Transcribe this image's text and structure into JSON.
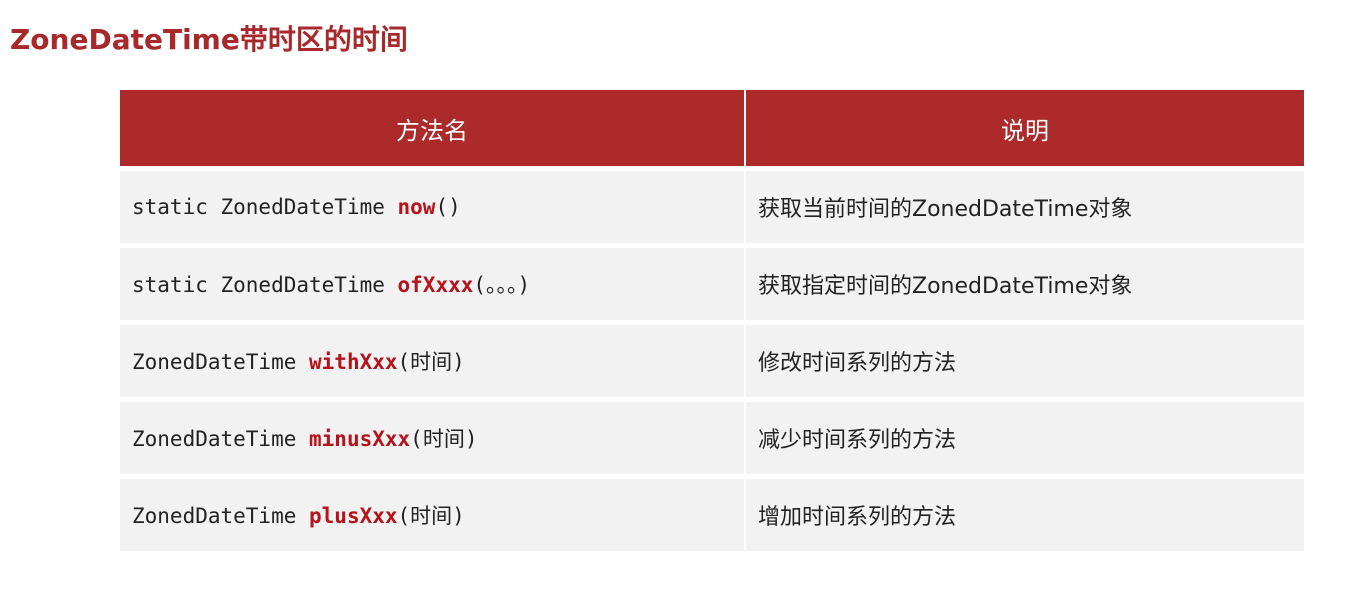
{
  "title": "ZoneDateTime带时区的时间",
  "colors": {
    "title": "#a8292b",
    "header_bg": "#ac2a29",
    "row_bg": "#f2f2f2",
    "method_highlight": "#b5121b"
  },
  "table": {
    "headers": [
      "方法名",
      "说明"
    ],
    "rows": [
      {
        "prefix": "static ZonedDateTime ",
        "method": "now",
        "suffix": "()",
        "description": "获取当前时间的ZonedDateTime对象"
      },
      {
        "prefix": "static ZonedDateTime ",
        "method": "ofXxxx",
        "suffix": "(。。。)",
        "description": "获取指定时间的ZonedDateTime对象"
      },
      {
        "prefix": "ZonedDateTime ",
        "method": "withXxx",
        "suffix": "(时间)",
        "description": "修改时间系列的方法"
      },
      {
        "prefix": "ZonedDateTime ",
        "method": "minusXxx",
        "suffix": "(时间)",
        "description": "减少时间系列的方法"
      },
      {
        "prefix": "ZonedDateTime ",
        "method": "plusXxx",
        "suffix": "(时间)",
        "description": "增加时间系列的方法"
      }
    ]
  }
}
